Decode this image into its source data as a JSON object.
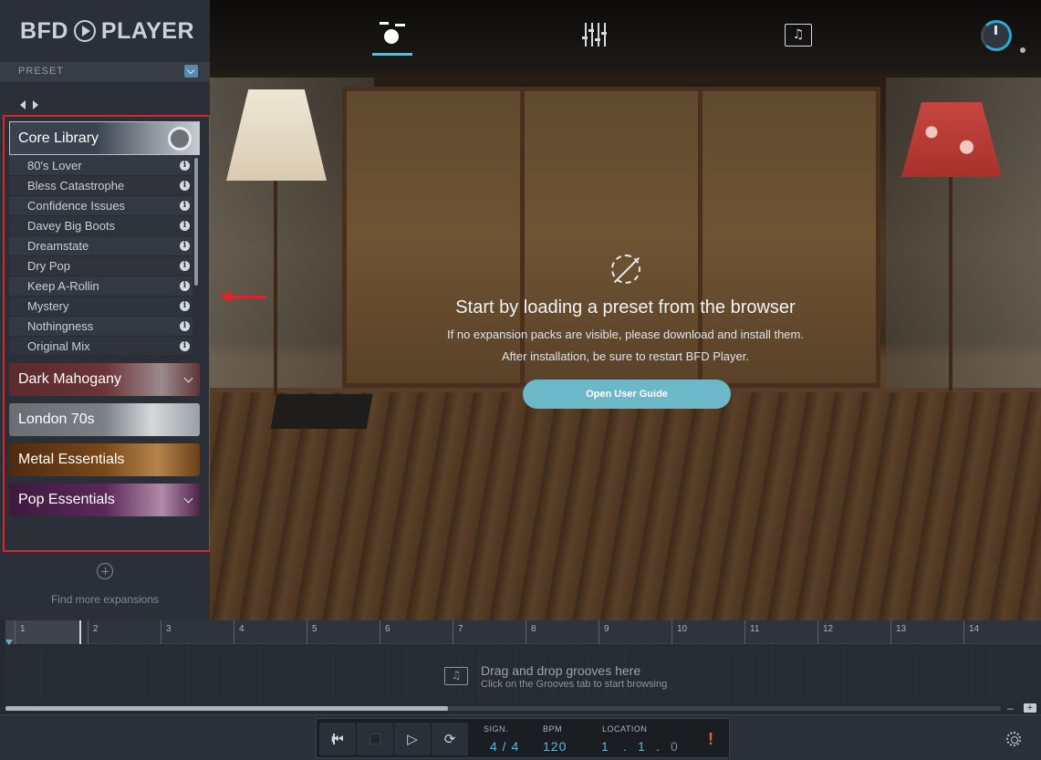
{
  "app": {
    "logo_text_left": "BFD",
    "logo_text_right": "PLAYER"
  },
  "sidebar": {
    "preset_label": "PRESET",
    "core_library": {
      "title": "Core Library",
      "presets": [
        "80's Lover",
        "Bless Catastrophe",
        "Confidence Issues",
        "Davey Big Boots",
        "Dreamstate",
        "Dry Pop",
        "Keep A-Rollin",
        "Mystery",
        "Nothingness",
        "Original Mix"
      ]
    },
    "packs": [
      "Dark Mahogany",
      "London 70s",
      "Metal Essentials",
      "Pop Essentials"
    ],
    "find_more": "Find more expansions"
  },
  "topnav": {
    "tabs": [
      "kit-icon",
      "mixer-icon",
      "grooves-icon"
    ],
    "active": "kit-icon",
    "accent": "#63b9cf"
  },
  "main": {
    "title": "Start by loading a preset from the browser",
    "line1": "If no expansion packs are visible, please download and install them.",
    "line2": "After installation, be sure to restart BFD Player.",
    "button": "Open User Guide"
  },
  "timeline": {
    "bars": [
      "1",
      "2",
      "3",
      "4",
      "5",
      "6",
      "7",
      "8",
      "9",
      "10",
      "11",
      "12",
      "13",
      "14"
    ],
    "drop_title": "Drag and drop grooves here",
    "drop_sub": "Click on the Grooves tab to start browsing",
    "zoom_minus": "–",
    "zoom_plus": "+"
  },
  "transport": {
    "sign_label": "SIGN.",
    "sign_value": "4 / 4",
    "bpm_label": "BPM",
    "bpm_value": "120",
    "location_label": "LOCATION",
    "location_bar": "1",
    "location_beat": "1",
    "location_tick": "0",
    "location_sep": ".",
    "warning": "!"
  },
  "colors": {
    "highlight_box": "#d6262c",
    "accent": "#5db6d6",
    "button": "#6db8c8",
    "warning": "#e0632e"
  }
}
